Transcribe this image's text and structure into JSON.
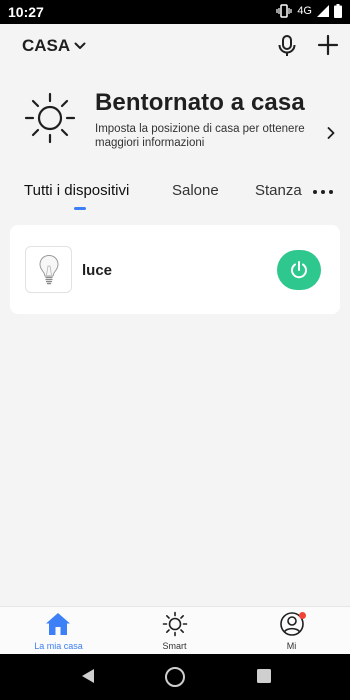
{
  "status": {
    "time": "10:27",
    "network": "4G"
  },
  "header": {
    "home_name": "CASA"
  },
  "welcome": {
    "title": "Bentornato a casa",
    "subtitle": "Imposta la posizione di casa per ottenere maggiori informazioni"
  },
  "tabs": [
    {
      "label": "Tutti i dispositivi"
    },
    {
      "label": "Salone"
    },
    {
      "label": "Stanza"
    }
  ],
  "devices": [
    {
      "name": "luce"
    }
  ],
  "bottom_nav": [
    {
      "label": "La mia casa"
    },
    {
      "label": "Smart"
    },
    {
      "label": "Mi"
    }
  ],
  "colors": {
    "accent": "#3d7ff6",
    "power_on": "#2ec78d",
    "badge": "#f14336"
  }
}
